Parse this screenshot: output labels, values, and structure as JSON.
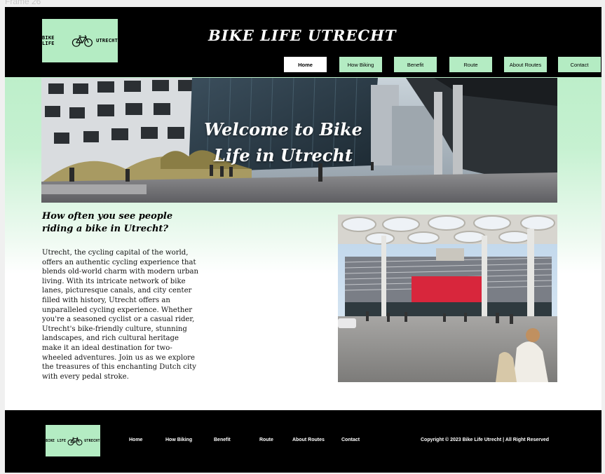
{
  "frame": {
    "label": "Frame 26"
  },
  "header": {
    "logo": {
      "left": "BIKE LIFE",
      "right": "UTRECHT",
      "icon": "bicycle-icon"
    },
    "site_title": "BIKE LIFE UTRECHT",
    "nav": [
      {
        "label": "Home",
        "active": true
      },
      {
        "label": "How Biking",
        "active": false
      },
      {
        "label": "Benefit",
        "active": false
      },
      {
        "label": "Route",
        "active": false
      },
      {
        "label": "About Routes",
        "active": false
      },
      {
        "label": "Contact",
        "active": false
      }
    ]
  },
  "hero": {
    "title_line1": "Welcome to Bike",
    "title_line2": "Life in Utrecht"
  },
  "main": {
    "heading": "How often you see people riding a bike in Utrecht?",
    "body": "Utrecht, the cycling capital of the world, offers an authentic cycling experience that blends old-world charm with modern urban living. With its intricate network of bike lanes, picturesque canals, and city center filled with history, Utrecht offers an unparalleled cycling experience. Whether you're a seasoned cyclist or a casual rider, Utrecht's bike-friendly culture, stunning landscapes, and rich cultural heritage make it an ideal destination for two-wheeled adventures. Join us as we explore the treasures of this enchanting Dutch city with every pedal stroke."
  },
  "footer": {
    "logo": {
      "left": "BIKE LIFE",
      "right": "UTRECHT"
    },
    "links": [
      "Home",
      "How Biking",
      "Benefit",
      "Route",
      "About Routes",
      "Contact"
    ],
    "copyright": "Copyright  © 2023 Bike Life Utrecht | All Right Reserved"
  },
  "colors": {
    "brand_green": "#b4ecc3",
    "header_bg": "#000000"
  }
}
